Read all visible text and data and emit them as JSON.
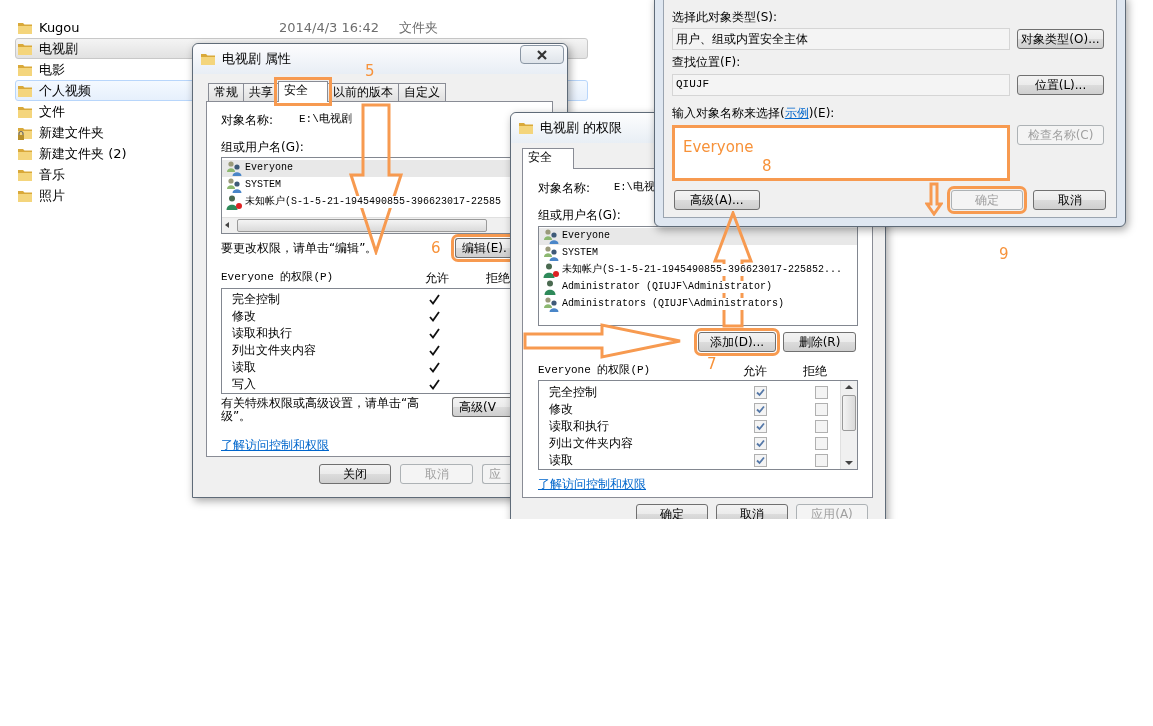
{
  "explorer": {
    "rows": [
      {
        "name": "Kugou",
        "date": "2014/4/3 16:42",
        "type": "文件夹",
        "selected": false,
        "hot": false,
        "locked": false
      },
      {
        "name": "电视剧",
        "selected": true,
        "hot": false,
        "locked": false
      },
      {
        "name": "电影",
        "selected": false,
        "hot": false,
        "locked": false
      },
      {
        "name": "个人视频",
        "selected": false,
        "hot": true,
        "locked": false
      },
      {
        "name": "文件",
        "selected": false,
        "hot": false,
        "locked": false
      },
      {
        "name": "新建文件夹",
        "selected": false,
        "hot": false,
        "locked": true
      },
      {
        "name": "新建文件夹 (2)",
        "selected": false,
        "hot": false,
        "locked": false
      },
      {
        "name": "音乐",
        "selected": false,
        "hot": false,
        "locked": false
      },
      {
        "name": "照片",
        "selected": false,
        "hot": false,
        "locked": false
      }
    ]
  },
  "properties_dialog": {
    "title": "电视剧 属性",
    "tabs": [
      {
        "label": "常规",
        "selected": false,
        "highlighted": false
      },
      {
        "label": "共享",
        "selected": false,
        "highlighted": false
      },
      {
        "label": "安全",
        "selected": true,
        "highlighted": true
      },
      {
        "label": "以前的版本",
        "selected": false,
        "highlighted": false
      },
      {
        "label": "自定义",
        "selected": false,
        "highlighted": false
      }
    ],
    "object_label": "对象名称:",
    "object_value": "E:\\电视剧",
    "group_label": "组或用户名(G):",
    "users": [
      {
        "name": "Everyone",
        "kind": "group",
        "selected": true
      },
      {
        "name": "SYSTEM",
        "kind": "group",
        "selected": false
      },
      {
        "name": "未知帐户(S-1-5-21-1945490855-396623017-22585",
        "kind": "unknown",
        "selected": false
      }
    ],
    "change_hint": "要更改权限，请单击“编辑”。",
    "edit_button": {
      "label": "编辑(E).",
      "highlighted": true
    },
    "perm_label": "Everyone 的权限(P)",
    "allow_header": "允许",
    "deny_header": "拒绝",
    "permissions": [
      {
        "name": "完全控制",
        "allowed": true
      },
      {
        "name": "修改",
        "allowed": true
      },
      {
        "name": "读取和执行",
        "allowed": true
      },
      {
        "name": "列出文件夹内容",
        "allowed": true
      },
      {
        "name": "读取",
        "allowed": true
      },
      {
        "name": "写入",
        "allowed": true
      }
    ],
    "advanced_hint": "有关特殊权限或高级设置，请单击“高级”。",
    "advanced_button": "高级(V",
    "help_link": "了解访问控制和权限",
    "buttons": [
      {
        "label": "关闭",
        "disabled": false
      },
      {
        "label": "取消",
        "disabled": true
      },
      {
        "label": "应",
        "disabled": true
      }
    ]
  },
  "permissions_dialog": {
    "title": "电视剧 的权限",
    "tabs": [
      {
        "label": "安全",
        "selected": true
      }
    ],
    "object_label": "对象名称:",
    "object_value": "E:\\电视",
    "group_label": "组或用户名(G):",
    "users": [
      {
        "name": "Everyone",
        "kind": "group",
        "selected": true
      },
      {
        "name": "SYSTEM",
        "kind": "group",
        "selected": false
      },
      {
        "name": "未知帐户(S-1-5-21-1945490855-396623017-225852...",
        "kind": "unknown",
        "selected": false
      },
      {
        "name": "Administrator (QIUJF\\Administrator)",
        "kind": "user",
        "selected": false
      },
      {
        "name": "Administrators (QIUJF\\Administrators)",
        "kind": "group",
        "selected": false
      }
    ],
    "add_button": {
      "label": "添加(D)...",
      "highlighted": true
    },
    "remove_button": "删除(R)",
    "perm_label": "Everyone 的权限(P)",
    "allow_header": "允许",
    "deny_header": "拒绝",
    "permissions": [
      {
        "name": "完全控制",
        "allowed": true,
        "denied": false
      },
      {
        "name": "修改",
        "allowed": true,
        "denied": false
      },
      {
        "name": "读取和执行",
        "allowed": true,
        "denied": false
      },
      {
        "name": "列出文件夹内容",
        "allowed": true,
        "denied": false
      },
      {
        "name": "读取",
        "allowed": true,
        "denied": false
      }
    ],
    "help_link": "了解访问控制和权限",
    "buttons": [
      {
        "label": "确定",
        "disabled": false
      },
      {
        "label": "取消",
        "disabled": false
      },
      {
        "label": "应用(A)",
        "disabled": true
      }
    ]
  },
  "select_users_dialog": {
    "type_label": "选择此对象类型(S):",
    "type_value": "用户、组或内置安全主体",
    "type_button": "对象类型(O)...",
    "location_label": "查找位置(F):",
    "location_value": "QIUJF",
    "location_button": "位置(L)...",
    "name_prompt_before": "输入对象名称来选择(",
    "name_prompt_link": "示例",
    "name_prompt_after": ")(E):",
    "name_value": "Everyone",
    "name_highlighted": true,
    "check_names_button": {
      "label": "检查名称(C)",
      "disabled": true
    },
    "advanced_button": "高级(A)...",
    "buttons": [
      {
        "label": "确定",
        "disabled": true,
        "highlighted": true
      },
      {
        "label": "取消",
        "disabled": false,
        "highlighted": false
      }
    ]
  },
  "annotations": {
    "steps": [
      "5",
      "6",
      "7",
      "8",
      "9"
    ]
  }
}
